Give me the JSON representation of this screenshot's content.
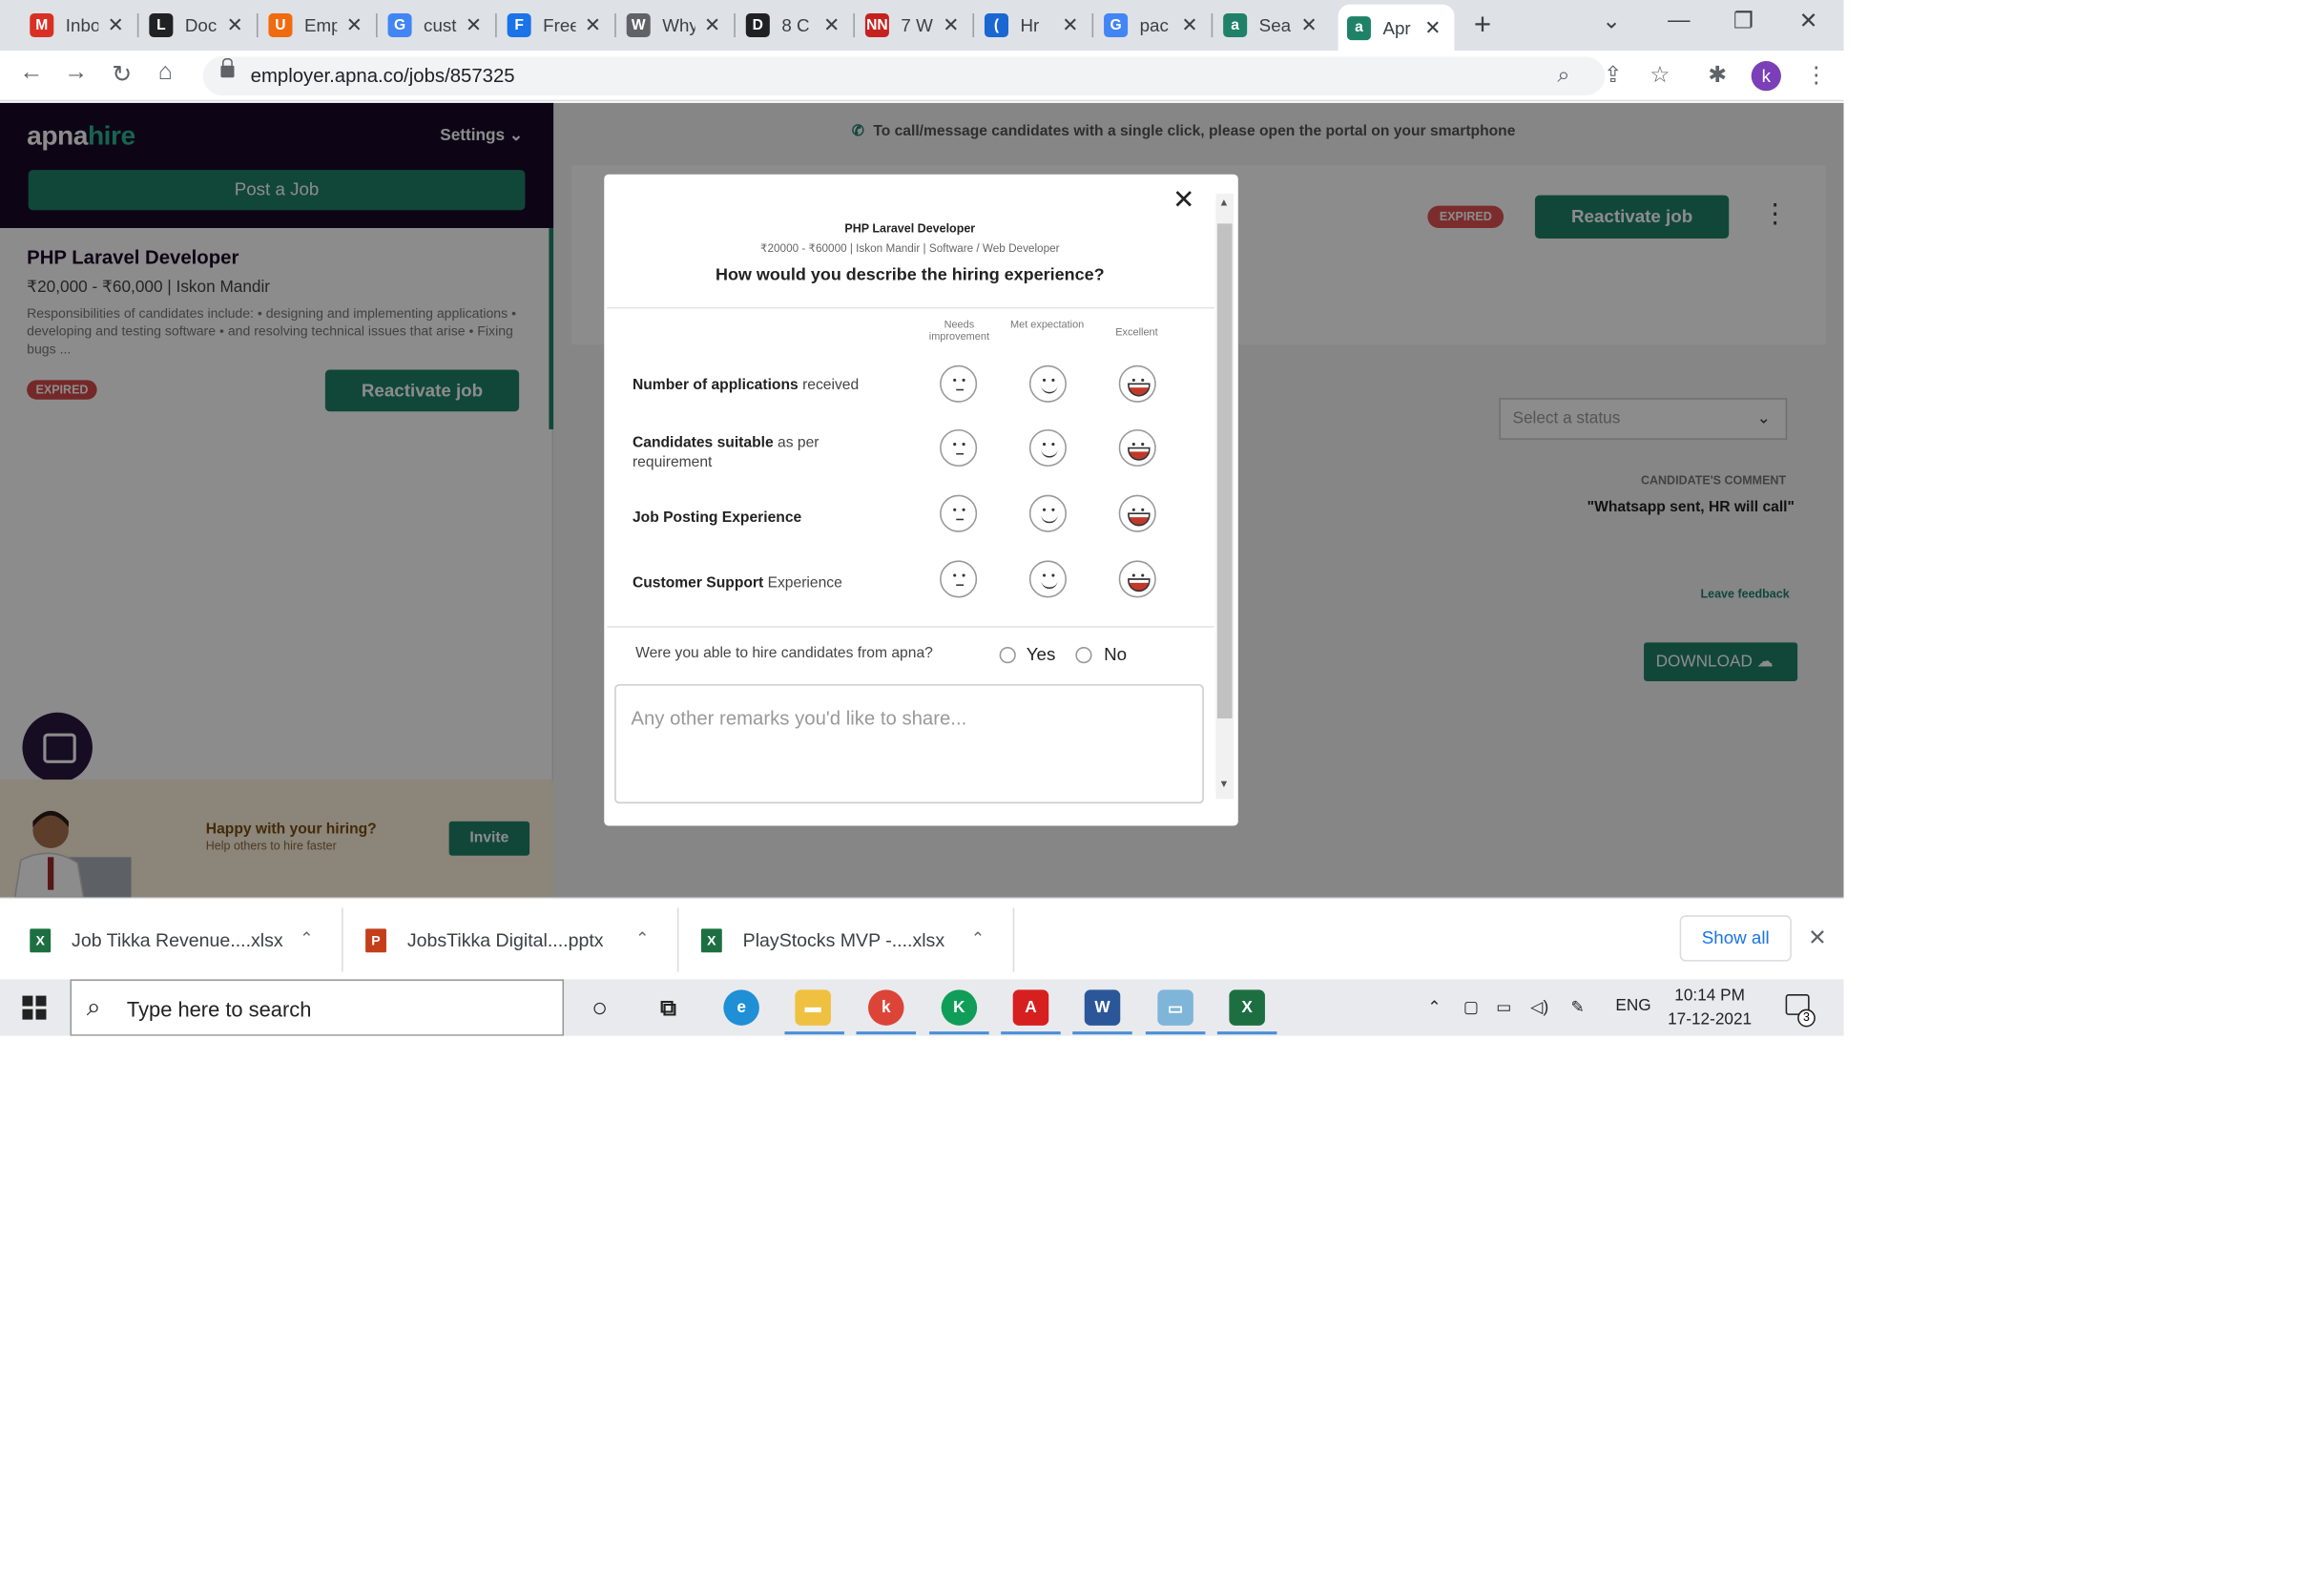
{
  "browser": {
    "tabs": [
      {
        "title": "Inbox",
        "icon": "gmail-icon",
        "color": "#d93025",
        "glyph": "M"
      },
      {
        "title": "Doc",
        "icon": "doc-icon",
        "color": "#202124",
        "glyph": "L"
      },
      {
        "title": "Emp",
        "icon": "emp-icon",
        "color": "#f06a0f",
        "glyph": "U"
      },
      {
        "title": "cust",
        "icon": "google-icon",
        "color": "#4285f4",
        "glyph": "G"
      },
      {
        "title": "Free",
        "icon": "free-icon",
        "color": "#1a73e8",
        "glyph": "F"
      },
      {
        "title": "Why",
        "icon": "globe-icon",
        "color": "#5f6368",
        "glyph": "W"
      },
      {
        "title": "8 C",
        "icon": "d-icon",
        "color": "#202124",
        "glyph": "D"
      },
      {
        "title": "7 W",
        "icon": "nn-icon",
        "color": "#c5221f",
        "glyph": "NN"
      },
      {
        "title": "Hr",
        "icon": "moon-icon",
        "color": "#1967d2",
        "glyph": "("
      },
      {
        "title": "pac",
        "icon": "google-icon",
        "color": "#4285f4",
        "glyph": "G"
      },
      {
        "title": "Sea",
        "icon": "apna-icon",
        "color": "#1f8268",
        "glyph": "a"
      },
      {
        "title": "Apr",
        "icon": "apna-icon",
        "color": "#1f8268",
        "glyph": "a"
      }
    ],
    "active_tab": 11,
    "url": "employer.apna.co/jobs/857325",
    "profile_initial": "k"
  },
  "sidebar": {
    "logo_a": "apna",
    "logo_b": "hire",
    "settings_label": "Settings",
    "post_job": "Post a Job",
    "job": {
      "title": "PHP Laravel Developer",
      "salary": "₹20,000 - ₹60,000 | Iskon Mandir",
      "description": "Responsibilities of candidates include: • designing and implementing applications • developing and testing software • and resolving technical issues that arise • Fixing bugs ...",
      "status": "EXPIRED",
      "reactivate": "Reactivate job"
    },
    "invite": {
      "title": "Happy with your hiring?",
      "subtitle": "Help others to hire faster",
      "button": "Invite"
    }
  },
  "main": {
    "notice": "To call/message candidates with a single click, please open the portal on your smartphone",
    "status": "EXPIRED",
    "reactivate": "Reactivate job",
    "status_placeholder": "Select a status",
    "comment_label": "CANDIDATE'S COMMENT",
    "comment_text": "\"Whatsapp sent, HR will call\"",
    "leave_feedback": "Leave feedback",
    "download": "DOWNLOAD"
  },
  "modal": {
    "job_title": "PHP Laravel Developer",
    "job_meta": "₹20000 - ₹60000 | Iskon Mandir | Software / Web Developer",
    "question": "How would you describe the hiring experience?",
    "columns": [
      "Needs improvement",
      "Met expectation",
      "Excellent"
    ],
    "rows": [
      {
        "bold": "Number of applications",
        "rest": " received"
      },
      {
        "bold": "Candidates suitable",
        "rest": " as per requirement"
      },
      {
        "bold": "Job Posting Experience",
        "rest": ""
      },
      {
        "bold": "Customer Support",
        "rest": " Experience"
      }
    ],
    "hire_question": "Were you able to hire candidates from apna?",
    "yes": "Yes",
    "no": "No",
    "remarks_placeholder": "Any other remarks you'd like to share..."
  },
  "downloads": {
    "items": [
      {
        "name": "Job Tikka Revenue....xlsx",
        "type": "excel",
        "color": "#1d6f42",
        "glyph": "X"
      },
      {
        "name": "JobsTikka Digital....pptx",
        "type": "powerpoint",
        "color": "#c43e1c",
        "glyph": "P"
      },
      {
        "name": "PlayStocks MVP -....xlsx",
        "type": "excel",
        "color": "#1d6f42",
        "glyph": "X"
      }
    ],
    "show_all": "Show all"
  },
  "taskbar": {
    "search_placeholder": "Type here to search",
    "language": "ENG",
    "time": "10:14 PM",
    "date": "17-12-2021",
    "notification_count": "3"
  }
}
